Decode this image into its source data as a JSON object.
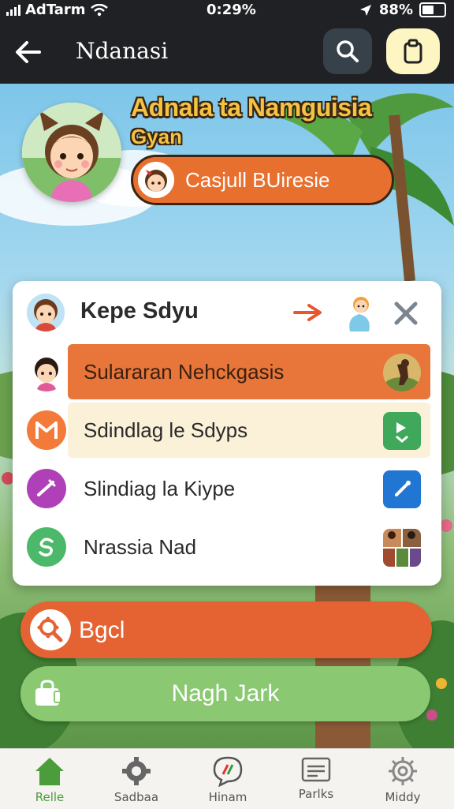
{
  "status_bar": {
    "carrier": "AdTarm",
    "time": "0:29%",
    "battery": "88%"
  },
  "header": {
    "title": "Ndanasi",
    "search_icon": "search-icon",
    "bag_icon": "clipboard-icon"
  },
  "hero": {
    "headline": "Adnala ta Namguisia",
    "subline": "Gyan",
    "profile_button": "Casjull BUiresie"
  },
  "card": {
    "title": "Kepe Sdyu",
    "rows": [
      {
        "label": "Sulararan Nehckgasis",
        "highlight": "#e8763a"
      },
      {
        "label": "Sdindlag le Sdyps",
        "highlight": "#fbf1d8"
      },
      {
        "label": "Slindiag la Kiype",
        "highlight": "#ffffff"
      },
      {
        "label": "Nrassia Nad",
        "highlight": "#ffffff"
      }
    ]
  },
  "actions": {
    "primary": "Bgcl",
    "secondary": "Nagh Jark"
  },
  "bottom_nav": [
    {
      "label": "Relle",
      "icon": "home-icon"
    },
    {
      "label": "Sadbaa",
      "icon": "gear-icon"
    },
    {
      "label": "Hinam",
      "icon": "chat-icon"
    },
    {
      "label": "Parlks",
      "icon": "mail-icon"
    },
    {
      "label": "Middy",
      "icon": "settings-icon"
    }
  ],
  "colors": {
    "accent_orange": "#e56332",
    "accent_green": "#8ac872",
    "header_bg": "#1f2124",
    "active_nav": "#4a9d3a"
  }
}
